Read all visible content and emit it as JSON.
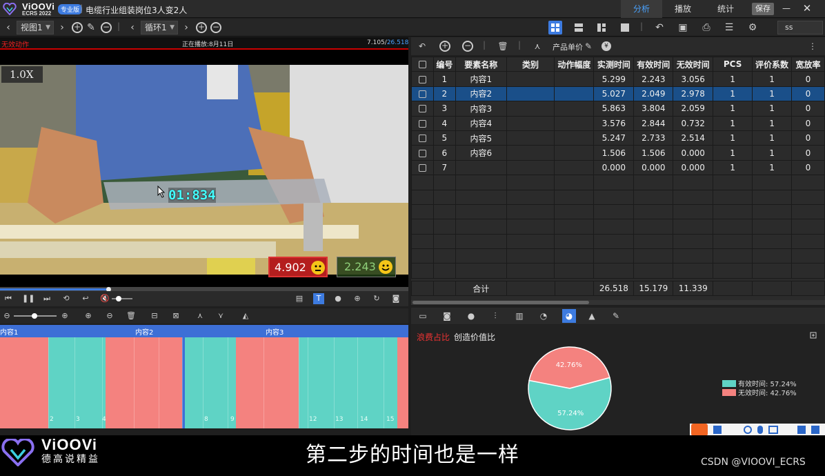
{
  "app": {
    "brand": "ViOOVi",
    "version": "ECRS 2022",
    "edition": "专业版",
    "doc_title": "电缆行业组装岗位3人变2人",
    "nav": [
      "分析",
      "播放",
      "统计"
    ],
    "save_label": "保存",
    "minimize": "—",
    "close": "✕"
  },
  "toolbar": {
    "view_select": "视图1",
    "loop_select": "循环1",
    "ss_value": "ss"
  },
  "video": {
    "invalid_action_label": "无效动作",
    "playing_label": "正在播放:8月11日",
    "time_current": "7.105/",
    "time_total": "26.518",
    "speed": "1.0X",
    "overlay_timer": "01:834",
    "invalid_value": "4.902",
    "valid_value": "2.243",
    "progress_fraction": 0.265
  },
  "timeline": {
    "segments_labels": [
      "内容1",
      "内容2",
      "内容3"
    ],
    "tick_numbers": [
      "2",
      "3",
      "4",
      "8",
      "9",
      "12",
      "13",
      "14",
      "15"
    ]
  },
  "table_toolbar": {
    "unit_price_label": "产品单价"
  },
  "table": {
    "headers": [
      "编号",
      "要素名称",
      "类别",
      "动作幅度",
      "实测时间",
      "有效时间",
      "无效时间",
      "PCS",
      "评价系数",
      "宽放率"
    ],
    "rows": [
      {
        "no": "1",
        "name": "内容1",
        "cat": "",
        "amp": "",
        "measured": "5.299",
        "valid": "2.243",
        "invalid": "3.056",
        "pcs": "1",
        "coef": "1",
        "allow": "0"
      },
      {
        "no": "2",
        "name": "内容2",
        "cat": "",
        "amp": "",
        "measured": "5.027",
        "valid": "2.049",
        "invalid": "2.978",
        "pcs": "1",
        "coef": "1",
        "allow": "0"
      },
      {
        "no": "3",
        "name": "内容3",
        "cat": "",
        "amp": "",
        "measured": "5.863",
        "valid": "3.804",
        "invalid": "2.059",
        "pcs": "1",
        "coef": "1",
        "allow": "0"
      },
      {
        "no": "4",
        "name": "内容4",
        "cat": "",
        "amp": "",
        "measured": "3.576",
        "valid": "2.844",
        "invalid": "0.732",
        "pcs": "1",
        "coef": "1",
        "allow": "0"
      },
      {
        "no": "5",
        "name": "内容5",
        "cat": "",
        "amp": "",
        "measured": "5.247",
        "valid": "2.733",
        "invalid": "2.514",
        "pcs": "1",
        "coef": "1",
        "allow": "0"
      },
      {
        "no": "6",
        "name": "内容6",
        "cat": "",
        "amp": "",
        "measured": "1.506",
        "valid": "1.506",
        "invalid": "0.000",
        "pcs": "1",
        "coef": "1",
        "allow": "0"
      },
      {
        "no": "7",
        "name": "",
        "cat": "",
        "amp": "",
        "measured": "0.000",
        "valid": "0.000",
        "invalid": "0.000",
        "pcs": "1",
        "coef": "1",
        "allow": "0"
      }
    ],
    "selected_row": 1,
    "total_label": "合计",
    "total_measured": "26.518",
    "total_valid": "15.179",
    "total_invalid": "11.339"
  },
  "chart_panel": {
    "tab_waste": "浪费占比",
    "tab_value": "创造价值比"
  },
  "chart_data": {
    "type": "pie",
    "slices": [
      {
        "label": "有效时间",
        "value": 57.24,
        "color": "#5fd3c5",
        "display": "57.24%"
      },
      {
        "label": "无效时间",
        "value": 42.76,
        "color": "#f4827f",
        "display": "42.76%"
      }
    ],
    "legend": [
      "有效时间: 57.24%",
      "无效时间: 42.76%"
    ],
    "legend_position": "right"
  },
  "footer": {
    "brand": "ViOOVi",
    "slogan": "德高说精益",
    "subtitle": "第二步的时间也是一样",
    "watermark": "CSDN @VIOOVI_ECRS"
  },
  "colors": {
    "valid": "#5fd3c5",
    "invalid": "#f4827f",
    "accent": "#3d7be0",
    "selected_row": "#1a4f89"
  }
}
